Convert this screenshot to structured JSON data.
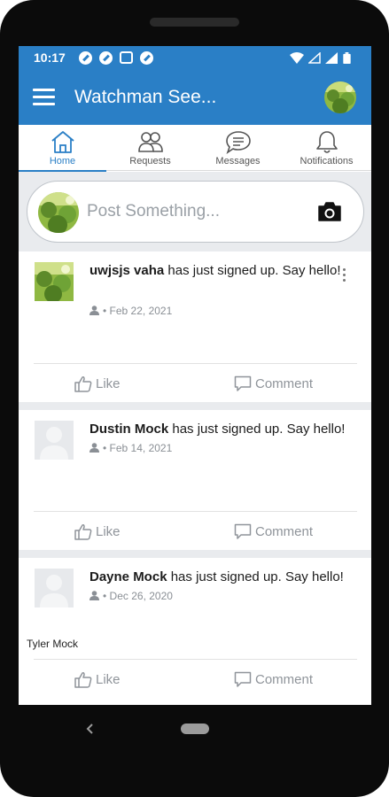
{
  "status_bar": {
    "time": "10:17"
  },
  "app_bar": {
    "title": "Watchman See..."
  },
  "tabs": [
    {
      "label": "Home",
      "icon": "home-icon",
      "active": true
    },
    {
      "label": "Requests",
      "icon": "people-icon",
      "active": false
    },
    {
      "label": "Messages",
      "icon": "chat-icon",
      "active": false
    },
    {
      "label": "Notifications",
      "icon": "bell-icon",
      "active": false
    }
  ],
  "composer": {
    "placeholder": "Post Something..."
  },
  "posts": [
    {
      "name": "uwjsjs vaha",
      "text": " has just signed up. Say hello!",
      "date": "Feb 22, 2021"
    },
    {
      "name": "Dustin Mock",
      "text": " has just signed up. Say hello!",
      "date": "Feb 14, 2021"
    },
    {
      "name": "Dayne Mock",
      "text": " has just signed up. Say hello!",
      "date": "Dec 26, 2020",
      "extra": "Tyler Mock"
    }
  ],
  "actions": {
    "like": "Like",
    "comment": "Comment"
  },
  "colors": {
    "brand": "#2a7fc6",
    "feed_bg": "#e9ebee"
  }
}
